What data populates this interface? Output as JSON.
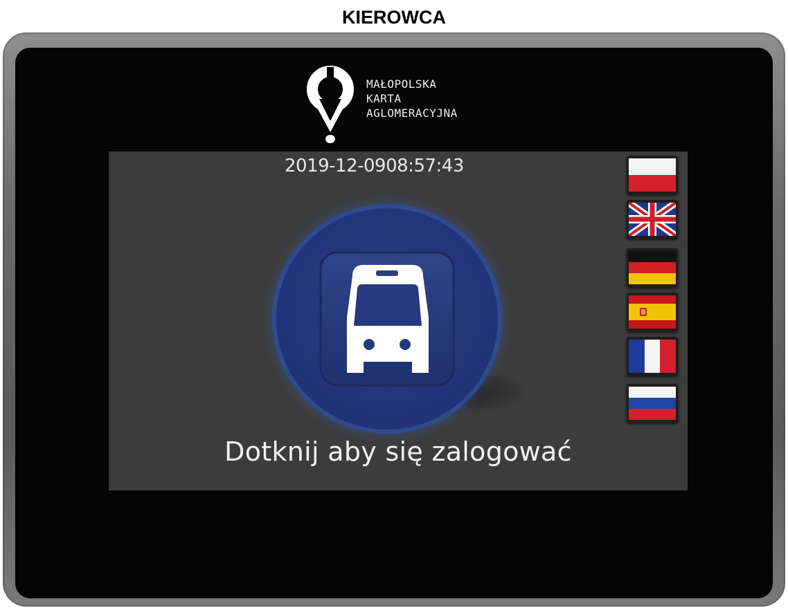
{
  "header": {
    "title": "KIEROWCA"
  },
  "logo": {
    "lines": [
      "MAŁOPOLSKA",
      "KARTA",
      "AGLOMERACYJNA"
    ]
  },
  "status": {
    "date": "2019-12-09",
    "time": "08:57:43"
  },
  "login": {
    "prompt": "Dotknij aby się zalogować"
  },
  "languages": [
    {
      "code": "pl",
      "icon": "poland-flag-icon"
    },
    {
      "code": "en",
      "icon": "uk-flag-icon"
    },
    {
      "code": "de",
      "icon": "germany-flag-icon"
    },
    {
      "code": "es",
      "icon": "spain-flag-icon"
    },
    {
      "code": "fr",
      "icon": "france-flag-icon"
    },
    {
      "code": "ru",
      "icon": "russia-flag-icon"
    }
  ],
  "colors": {
    "panel": "#3c3c3c",
    "screen": "#050505",
    "bus_circle": "#22357a",
    "bus_tile": "#253a7e"
  }
}
